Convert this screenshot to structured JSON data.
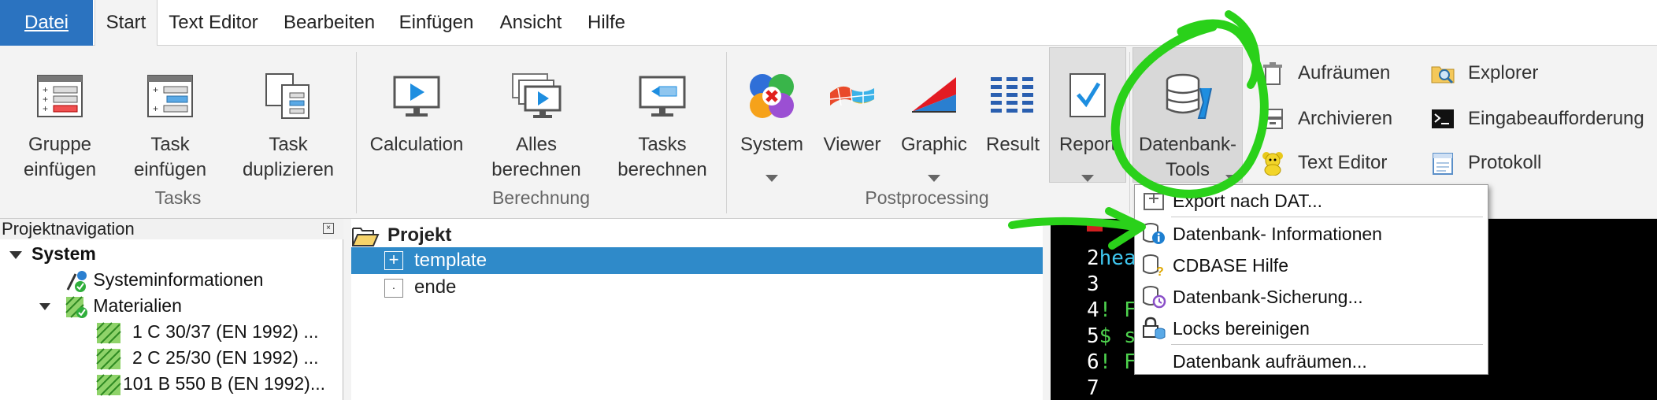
{
  "menu": {
    "file": "Datei",
    "tabs": [
      "Start",
      "Text Editor",
      "Bearbeiten",
      "Einfügen",
      "Ansicht",
      "Hilfe"
    ]
  },
  "ribbon": {
    "tasks": {
      "label": "Tasks",
      "buttons": [
        {
          "line1": "Gruppe",
          "line2": "einfügen"
        },
        {
          "line1": "Task",
          "line2": "einfügen"
        },
        {
          "line1": "Task",
          "line2": "duplizieren"
        }
      ]
    },
    "berechnung": {
      "label": "Berechnung",
      "buttons": [
        {
          "line1": "Calculation",
          "line2": ""
        },
        {
          "line1": "Alles",
          "line2": "berechnen"
        },
        {
          "line1": "Tasks",
          "line2": "berechnen"
        }
      ]
    },
    "postprocessing": {
      "label": "Postprocessing",
      "buttons": [
        "System",
        "Viewer",
        "Graphic",
        "Result",
        "Report"
      ]
    },
    "datenbank": {
      "line1": "Datenbank-",
      "line2": "Tools"
    },
    "small_col1": [
      "Aufräumen",
      "Archivieren",
      "Text Editor"
    ],
    "small_col2": [
      "Explorer",
      "Eingabeaufforderung",
      "Protokoll"
    ]
  },
  "nav": {
    "title": "Projektnavigation",
    "close_glyph": "×",
    "items": [
      "System",
      "Systeminformationen",
      "Materialien",
      "1 C 30/37 (EN 1992) ...",
      "2 C 25/30 (EN 1992) ...",
      "101 B 550 B (EN 1992)..."
    ]
  },
  "tree": {
    "root": "Projekt",
    "items": [
      "template",
      "ende"
    ]
  },
  "editor": {
    "line_numbers": [
      "2",
      "3",
      "4",
      "5",
      "6",
      "7"
    ],
    "fragments": [
      "hea",
      "",
      "! F",
      "$ s",
      "! F",
      ""
    ]
  },
  "dropdown": {
    "items": [
      "Export nach DAT...",
      "Datenbank- Informationen",
      "CDBASE Hilfe",
      "Datenbank-Sicherung...",
      "Locks bereinigen",
      "Datenbank aufräumen..."
    ]
  },
  "colors": {
    "file_tab": "#2b73c0",
    "selection": "#2f8ac9",
    "annotation": "#2ad11a",
    "editor_bg": "#000000"
  }
}
